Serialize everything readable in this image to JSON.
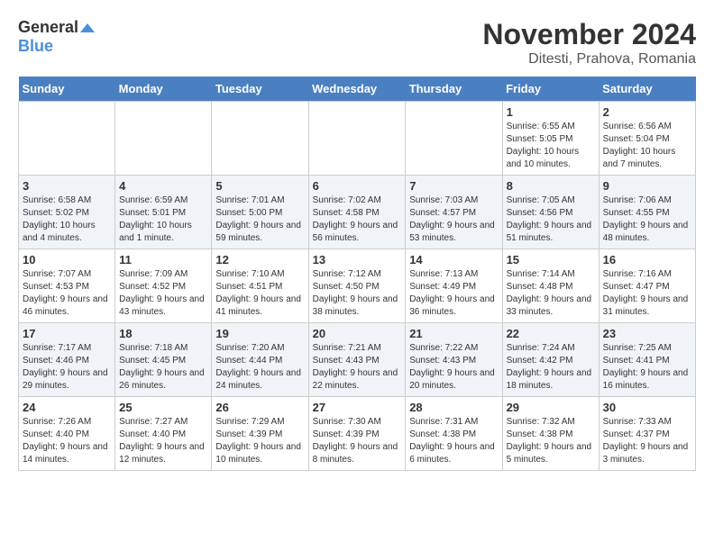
{
  "header": {
    "logo_general": "General",
    "logo_blue": "Blue",
    "month": "November 2024",
    "location": "Ditesti, Prahova, Romania"
  },
  "weekdays": [
    "Sunday",
    "Monday",
    "Tuesday",
    "Wednesday",
    "Thursday",
    "Friday",
    "Saturday"
  ],
  "rows": [
    [
      {
        "day": "",
        "info": ""
      },
      {
        "day": "",
        "info": ""
      },
      {
        "day": "",
        "info": ""
      },
      {
        "day": "",
        "info": ""
      },
      {
        "day": "",
        "info": ""
      },
      {
        "day": "1",
        "info": "Sunrise: 6:55 AM\nSunset: 5:05 PM\nDaylight: 10 hours and 10 minutes."
      },
      {
        "day": "2",
        "info": "Sunrise: 6:56 AM\nSunset: 5:04 PM\nDaylight: 10 hours and 7 minutes."
      }
    ],
    [
      {
        "day": "3",
        "info": "Sunrise: 6:58 AM\nSunset: 5:02 PM\nDaylight: 10 hours and 4 minutes."
      },
      {
        "day": "4",
        "info": "Sunrise: 6:59 AM\nSunset: 5:01 PM\nDaylight: 10 hours and 1 minute."
      },
      {
        "day": "5",
        "info": "Sunrise: 7:01 AM\nSunset: 5:00 PM\nDaylight: 9 hours and 59 minutes."
      },
      {
        "day": "6",
        "info": "Sunrise: 7:02 AM\nSunset: 4:58 PM\nDaylight: 9 hours and 56 minutes."
      },
      {
        "day": "7",
        "info": "Sunrise: 7:03 AM\nSunset: 4:57 PM\nDaylight: 9 hours and 53 minutes."
      },
      {
        "day": "8",
        "info": "Sunrise: 7:05 AM\nSunset: 4:56 PM\nDaylight: 9 hours and 51 minutes."
      },
      {
        "day": "9",
        "info": "Sunrise: 7:06 AM\nSunset: 4:55 PM\nDaylight: 9 hours and 48 minutes."
      }
    ],
    [
      {
        "day": "10",
        "info": "Sunrise: 7:07 AM\nSunset: 4:53 PM\nDaylight: 9 hours and 46 minutes."
      },
      {
        "day": "11",
        "info": "Sunrise: 7:09 AM\nSunset: 4:52 PM\nDaylight: 9 hours and 43 minutes."
      },
      {
        "day": "12",
        "info": "Sunrise: 7:10 AM\nSunset: 4:51 PM\nDaylight: 9 hours and 41 minutes."
      },
      {
        "day": "13",
        "info": "Sunrise: 7:12 AM\nSunset: 4:50 PM\nDaylight: 9 hours and 38 minutes."
      },
      {
        "day": "14",
        "info": "Sunrise: 7:13 AM\nSunset: 4:49 PM\nDaylight: 9 hours and 36 minutes."
      },
      {
        "day": "15",
        "info": "Sunrise: 7:14 AM\nSunset: 4:48 PM\nDaylight: 9 hours and 33 minutes."
      },
      {
        "day": "16",
        "info": "Sunrise: 7:16 AM\nSunset: 4:47 PM\nDaylight: 9 hours and 31 minutes."
      }
    ],
    [
      {
        "day": "17",
        "info": "Sunrise: 7:17 AM\nSunset: 4:46 PM\nDaylight: 9 hours and 29 minutes."
      },
      {
        "day": "18",
        "info": "Sunrise: 7:18 AM\nSunset: 4:45 PM\nDaylight: 9 hours and 26 minutes."
      },
      {
        "day": "19",
        "info": "Sunrise: 7:20 AM\nSunset: 4:44 PM\nDaylight: 9 hours and 24 minutes."
      },
      {
        "day": "20",
        "info": "Sunrise: 7:21 AM\nSunset: 4:43 PM\nDaylight: 9 hours and 22 minutes."
      },
      {
        "day": "21",
        "info": "Sunrise: 7:22 AM\nSunset: 4:43 PM\nDaylight: 9 hours and 20 minutes."
      },
      {
        "day": "22",
        "info": "Sunrise: 7:24 AM\nSunset: 4:42 PM\nDaylight: 9 hours and 18 minutes."
      },
      {
        "day": "23",
        "info": "Sunrise: 7:25 AM\nSunset: 4:41 PM\nDaylight: 9 hours and 16 minutes."
      }
    ],
    [
      {
        "day": "24",
        "info": "Sunrise: 7:26 AM\nSunset: 4:40 PM\nDaylight: 9 hours and 14 minutes."
      },
      {
        "day": "25",
        "info": "Sunrise: 7:27 AM\nSunset: 4:40 PM\nDaylight: 9 hours and 12 minutes."
      },
      {
        "day": "26",
        "info": "Sunrise: 7:29 AM\nSunset: 4:39 PM\nDaylight: 9 hours and 10 minutes."
      },
      {
        "day": "27",
        "info": "Sunrise: 7:30 AM\nSunset: 4:39 PM\nDaylight: 9 hours and 8 minutes."
      },
      {
        "day": "28",
        "info": "Sunrise: 7:31 AM\nSunset: 4:38 PM\nDaylight: 9 hours and 6 minutes."
      },
      {
        "day": "29",
        "info": "Sunrise: 7:32 AM\nSunset: 4:38 PM\nDaylight: 9 hours and 5 minutes."
      },
      {
        "day": "30",
        "info": "Sunrise: 7:33 AM\nSunset: 4:37 PM\nDaylight: 9 hours and 3 minutes."
      }
    ]
  ]
}
